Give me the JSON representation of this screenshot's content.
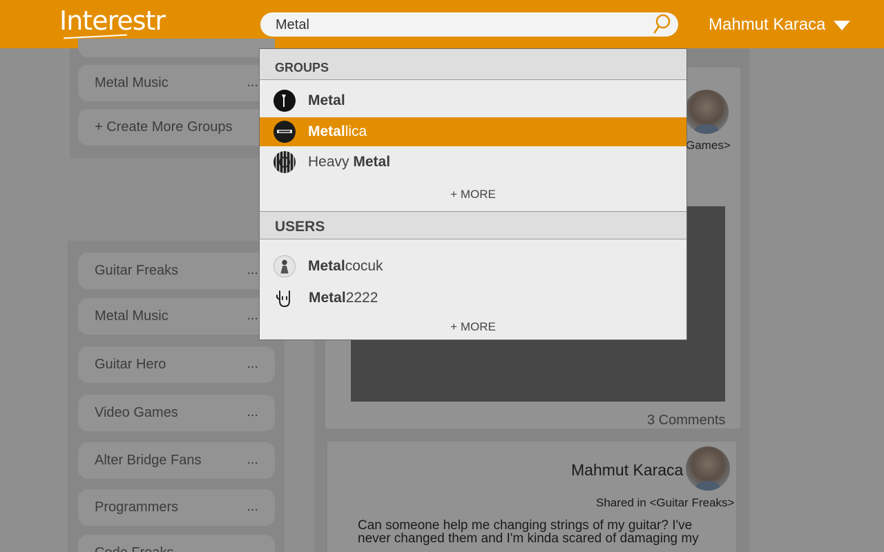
{
  "header": {
    "logo": "Interestr",
    "search_value": "Metal",
    "user_name": "Mahmut Karaca"
  },
  "left_top": {
    "items": [
      {
        "label": "Metal Music",
        "more": "..."
      }
    ],
    "create_label": "+ Create More Groups"
  },
  "left_groups": {
    "items": [
      {
        "label": "Guitar Freaks",
        "more": "..."
      },
      {
        "label": "Metal Music",
        "more": "..."
      },
      {
        "label": "Guitar Hero",
        "more": "..."
      },
      {
        "label": "Video Games",
        "more": "..."
      },
      {
        "label": "Alter Bridge Fans",
        "more": "..."
      },
      {
        "label": "Programmers",
        "more": "..."
      },
      {
        "label": "Code Freaks",
        "more": ""
      }
    ]
  },
  "feed": {
    "post1": {
      "shared_in_partial": "Games>",
      "comments": "3 Comments"
    },
    "post2": {
      "author": "Mahmut Karaca",
      "shared_in": "Shared in <Guitar Freaks>",
      "text": "Can someone help me changing strings of my guitar? I've never changed them and I'm kinda scared of damaging my"
    }
  },
  "dropdown": {
    "groups_heading": "GROUPS",
    "groups": [
      {
        "match": "Metal",
        "rest": "",
        "prefix": "",
        "icon": "metal-group-icon"
      },
      {
        "match": "Metal",
        "rest": "lica",
        "prefix": "",
        "icon": "metallica-logo-icon",
        "selected": true
      },
      {
        "match": "Metal",
        "rest": "",
        "prefix": "Heavy ",
        "icon": "heavy-metal-icon"
      }
    ],
    "groups_more": "+ MORE",
    "users_heading": "USERS",
    "users": [
      {
        "match": "Metal",
        "rest": "cocuk",
        "icon": "metalcocuk-avatar-icon"
      },
      {
        "match": "Metal",
        "rest": "2222",
        "icon": "rock-hand-icon"
      }
    ],
    "users_more": "+ MORE"
  },
  "colors": {
    "accent": "#e38e00",
    "overlay_bg": "#8f8f8f",
    "dropdown_bg": "#ececec"
  }
}
